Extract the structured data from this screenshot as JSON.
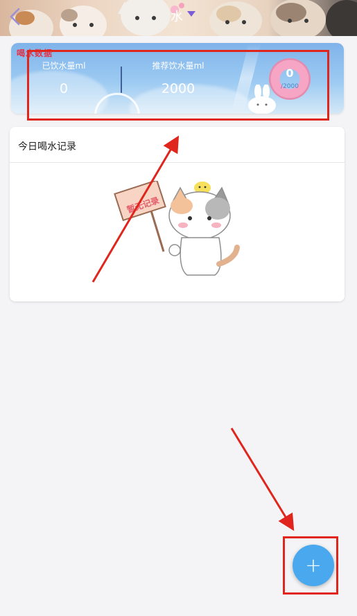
{
  "header": {
    "title": "水",
    "back_icon": "back-chevron-icon",
    "dropdown_icon": "dropdown-triangle-icon"
  },
  "summary": {
    "card_label": "喝水数据",
    "drunk": {
      "label": "已饮水量ml",
      "value": "0"
    },
    "recommended": {
      "label": "推荐饮水量ml",
      "value": "2000"
    },
    "progress": {
      "value": "0",
      "total": "/2000",
      "fraction": 0
    }
  },
  "records": {
    "title": "今日喝水记录",
    "empty_sign_text": "暂无记录"
  },
  "fab": {
    "label": "+"
  },
  "colors": {
    "annotation_red": "#e0251c",
    "fab_blue": "#4aa9ee",
    "card_blue": "#7fb3ea"
  }
}
